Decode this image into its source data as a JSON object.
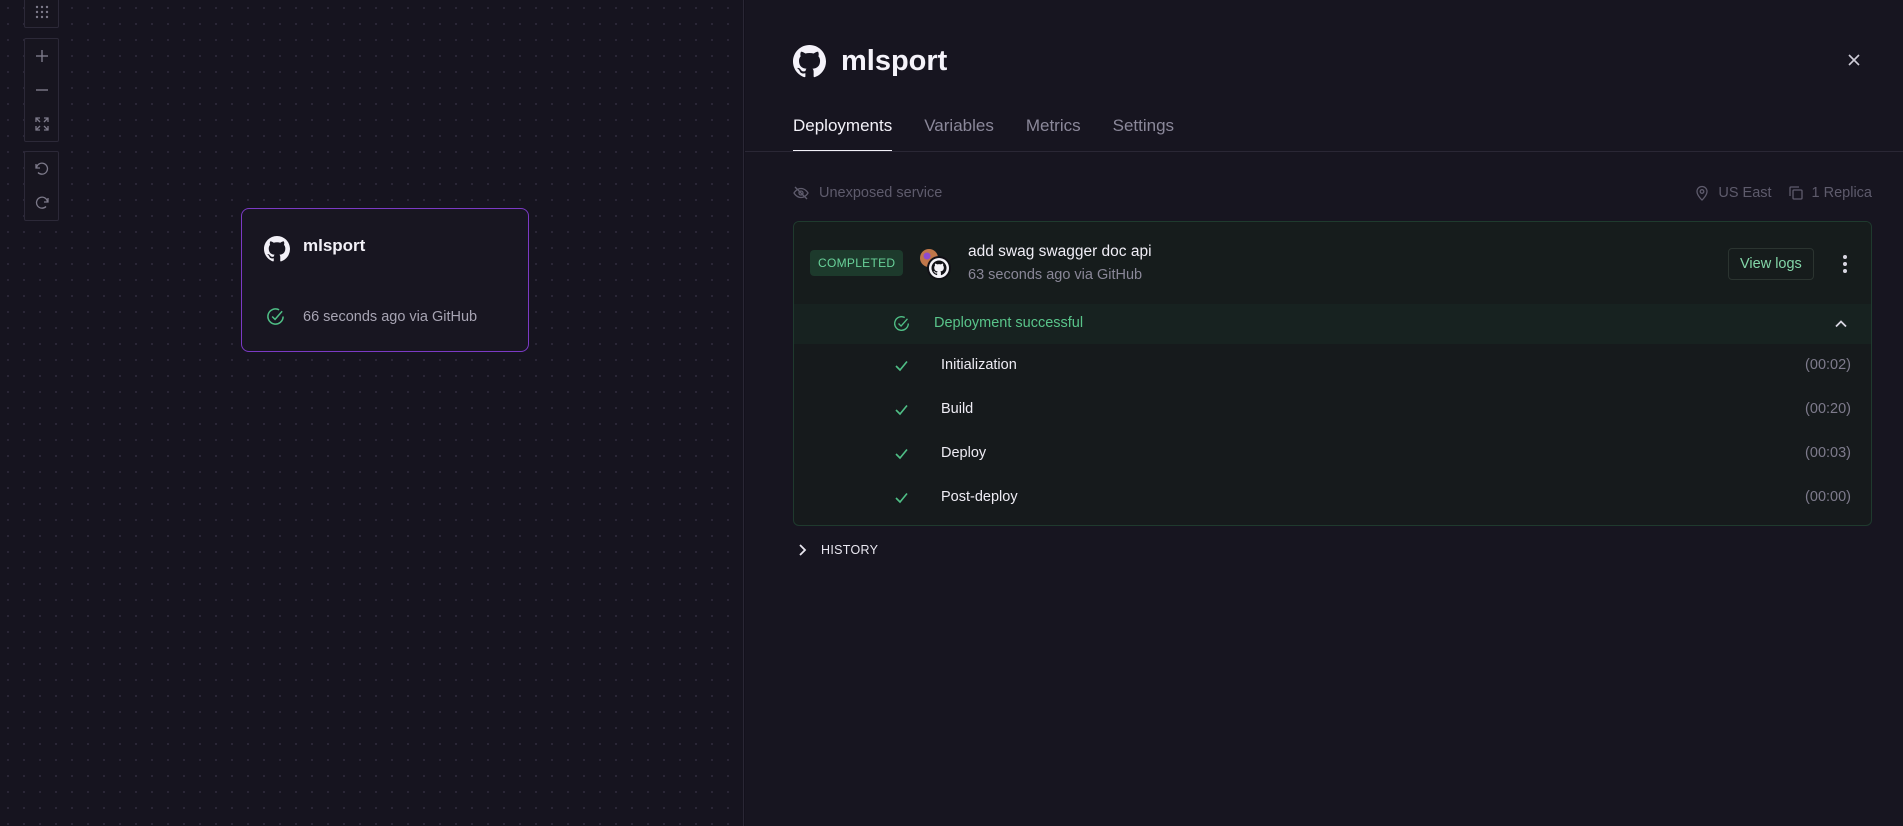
{
  "canvas": {
    "toolbar": {
      "icons": [
        "grid-icon",
        "zoom-in-icon",
        "zoom-out-icon",
        "fit-view-icon",
        "undo-icon",
        "redo-icon"
      ]
    },
    "service_card": {
      "name": "mlsport",
      "status": "66 seconds ago via GitHub",
      "border_color": "#7b3ac4"
    }
  },
  "panel": {
    "title": "mlsport",
    "tabs": [
      {
        "label": "Deployments",
        "active": true
      },
      {
        "label": "Variables",
        "active": false
      },
      {
        "label": "Metrics",
        "active": false
      },
      {
        "label": "Settings",
        "active": false
      }
    ],
    "meta": {
      "exposure": "Unexposed service",
      "region": "US East",
      "replicas": "1 Replica"
    },
    "deployment": {
      "status_badge": "COMPLETED",
      "commit_message": "add swag swagger doc api",
      "commit_sub": "63 seconds ago via GitHub",
      "view_logs_label": "View logs",
      "result": "Deployment successful",
      "steps": [
        {
          "label": "Initialization",
          "duration": "(00:02)"
        },
        {
          "label": "Build",
          "duration": "(00:20)"
        },
        {
          "label": "Deploy",
          "duration": "(00:03)"
        },
        {
          "label": "Post-deploy",
          "duration": "(00:00)"
        }
      ]
    },
    "history_label": "HISTORY"
  },
  "colors": {
    "accent_green": "#59c48a",
    "badge_bg": "#1d3a2c",
    "card_border": "#7b3ac4"
  }
}
